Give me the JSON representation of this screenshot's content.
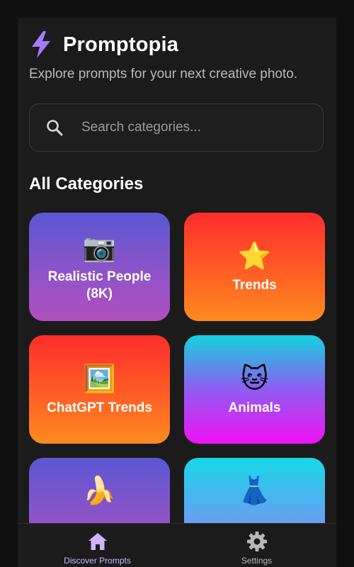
{
  "header": {
    "app_title": "Promptopia",
    "icon": "lightning-bolt-icon",
    "accent_color": "#a67cff",
    "subtitle": "Explore prompts for your next creative photo."
  },
  "search": {
    "placeholder": "Search categories...",
    "value": "",
    "icon": "search-icon"
  },
  "section": {
    "title": "All Categories"
  },
  "categories": [
    {
      "emoji": "📷",
      "icon": "camera-icon",
      "label": "Realistic People (8K)",
      "gradient": [
        "#5a57d2",
        "#b04fbf"
      ]
    },
    {
      "emoji": "⭐",
      "icon": "star-icon",
      "label": "Trends",
      "gradient": [
        "#ff2d2d",
        "#ff8a1f"
      ]
    },
    {
      "emoji": "🖼️",
      "icon": "framed-picture-icon",
      "label": "ChatGPT Trends",
      "gradient": [
        "#ff2d2d",
        "#ff8a1f"
      ]
    },
    {
      "emoji": "🐱",
      "icon": "cat-icon",
      "label": "Animals",
      "gradient": [
        "#13d3df",
        "#f012f5"
      ]
    },
    {
      "emoji": "🍌",
      "icon": "banana-icon",
      "label": "",
      "gradient": [
        "#5a57d2",
        "#b04fbf"
      ]
    },
    {
      "emoji": "👗",
      "icon": "dress-icon",
      "label": "",
      "gradient": [
        "#17d8e6",
        "#8a7df4"
      ]
    }
  ],
  "bottom_nav": [
    {
      "label": "Discover Prompts",
      "icon": "home-icon",
      "active": true
    },
    {
      "label": "Settings",
      "icon": "gear-icon",
      "active": false
    }
  ]
}
